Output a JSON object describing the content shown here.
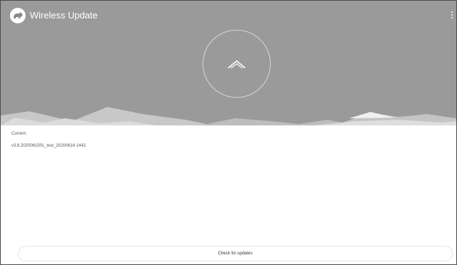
{
  "app": {
    "title": "Wireless Update",
    "logo_icon": "rhino-logo-icon",
    "menu_icon": "more-vert-icon"
  },
  "header": {
    "background": "#9a9a9a",
    "center_icon": "chevron-up-icon"
  },
  "current": {
    "label": "Current:",
    "version": "v3.8.2020061501_test_20200616-1442"
  },
  "actions": {
    "check_label": "Check for updates"
  }
}
